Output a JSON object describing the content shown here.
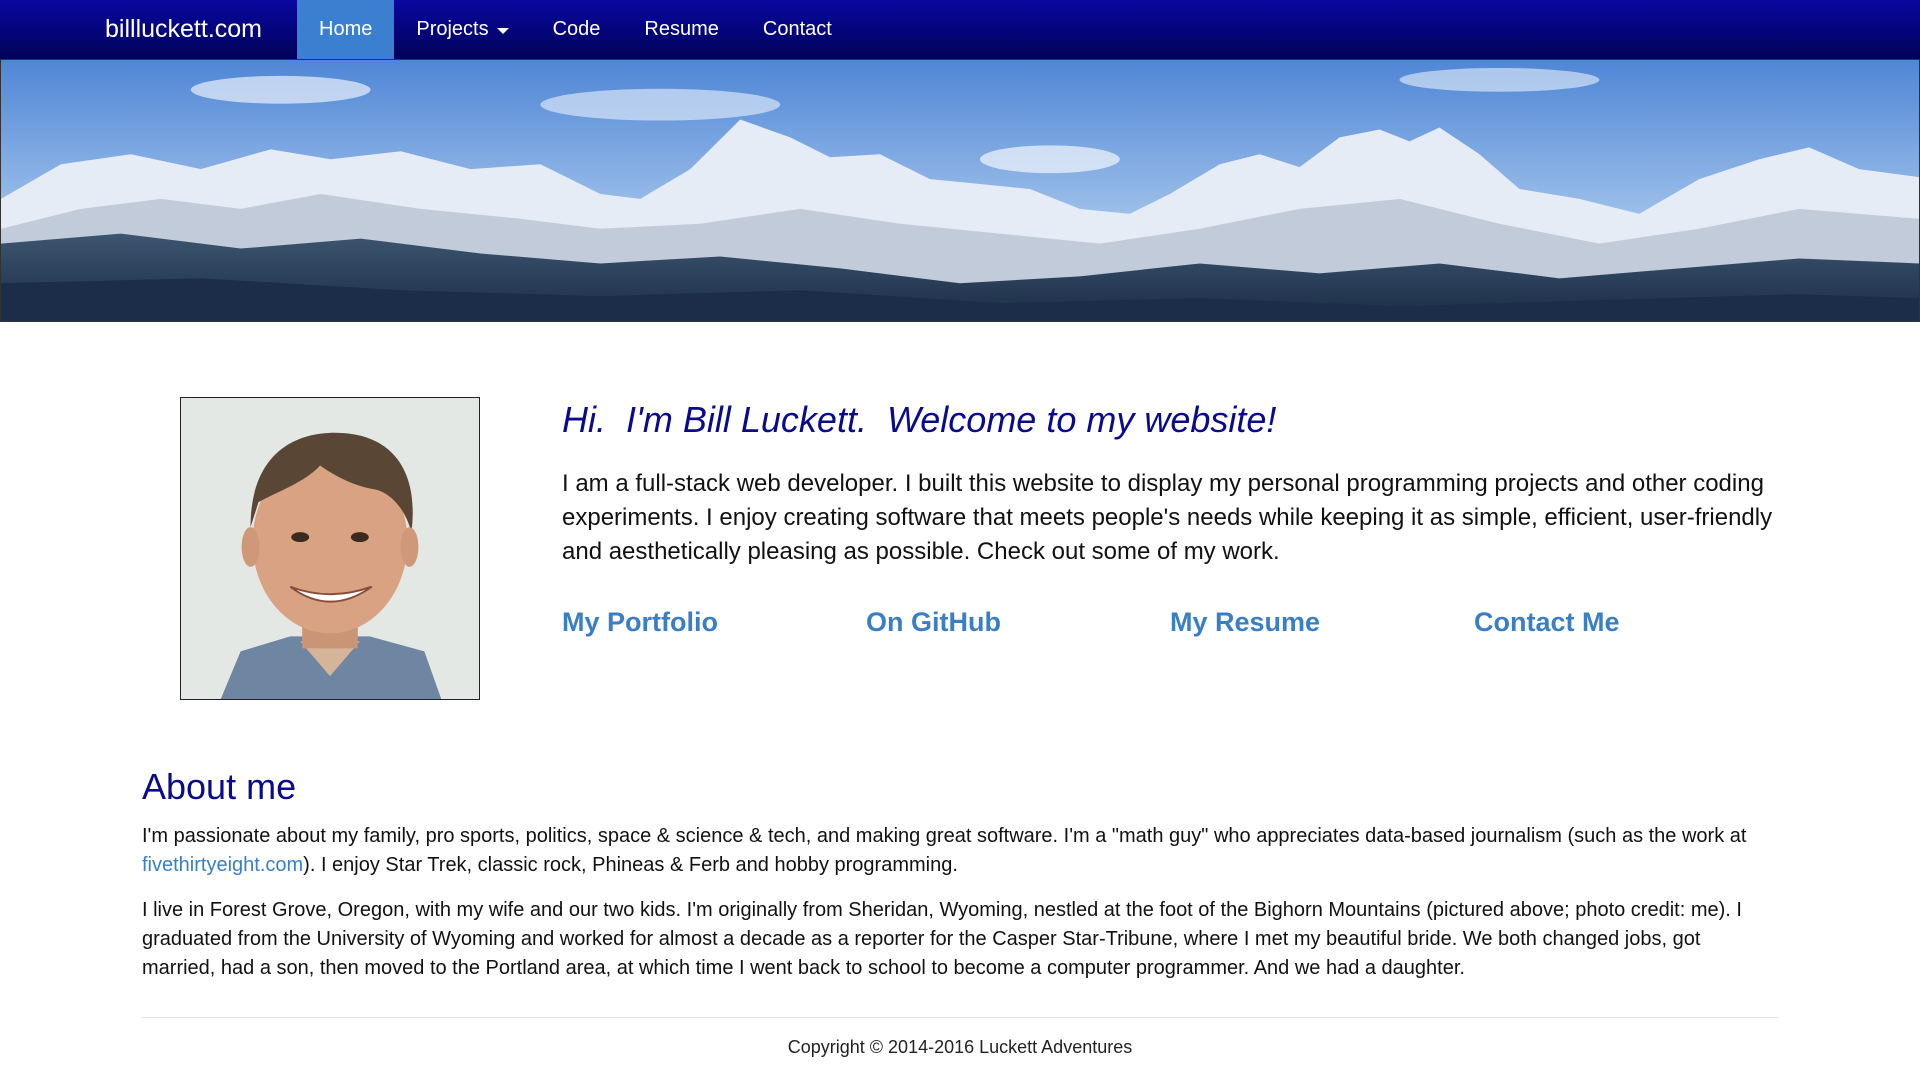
{
  "nav": {
    "brand": "billluckett.com",
    "items": [
      {
        "label": "Home",
        "active": true
      },
      {
        "label": "Projects",
        "dropdown": true
      },
      {
        "label": "Code"
      },
      {
        "label": "Resume"
      },
      {
        "label": "Contact"
      }
    ]
  },
  "intro": {
    "heading": "Hi.  I'm Bill Luckett.  Welcome to my website!",
    "text": "I am a full-stack web developer. I built this website to display my personal programming projects and other coding experiments. I enjoy creating software that meets people's needs while keeping it as simple, efficient, user-friendly and aesthetically pleasing as possible. Check out some of my work.",
    "links": [
      "My Portfolio",
      "On GitHub",
      "My Resume",
      "Contact Me"
    ]
  },
  "about": {
    "heading": "About me",
    "p1_before": "I'm passionate about my family, pro sports, politics, space & science & tech, and making great software. I'm a \"math guy\" who appreciates data-based journalism (such as the work at ",
    "p1_link": "fivethirtyeight.com",
    "p1_after": "). I enjoy Star Trek, classic rock, Phineas & Ferb and hobby programming.",
    "p2": "I live in Forest Grove, Oregon, with my wife and our two kids. I'm originally from Sheridan, Wyoming, nestled at the foot of the Bighorn Mountains (pictured above; photo credit: me). I graduated from the University of Wyoming and worked for almost a decade as a reporter for the Casper Star-Tribune, where I met my beautiful bride. We both changed jobs, got married, had a son, then moved to the Portland area, at which time I went back to school to become a computer programmer. And we had a daughter."
  },
  "footer": {
    "copyright": "Copyright © 2014-2016 Luckett Adventures"
  },
  "colors": {
    "nav_bg": "#04047a",
    "nav_active": "#3a7fd0",
    "heading": "#0a0a8c",
    "link": "#3a7fc4"
  }
}
